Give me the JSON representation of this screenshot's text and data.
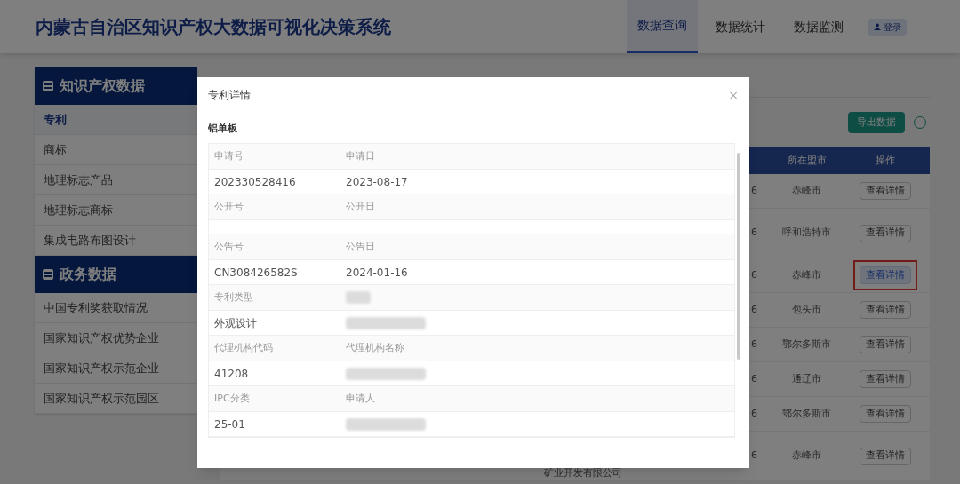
{
  "header": {
    "title": "内蒙古自治区知识产权大数据可视化决策系统",
    "nav": [
      {
        "label": "数据查询",
        "selected": true
      },
      {
        "label": "数据统计",
        "selected": false
      },
      {
        "label": "数据监测",
        "selected": false
      }
    ],
    "login": "登录"
  },
  "sidebar": {
    "groups": [
      {
        "title": "知识产权数据",
        "items": [
          {
            "label": "专利",
            "selected": true
          },
          {
            "label": "商标",
            "selected": false
          },
          {
            "label": "地理标志产品",
            "selected": false
          },
          {
            "label": "地理标志商标",
            "selected": false
          },
          {
            "label": "集成电路布图设计",
            "selected": false
          }
        ]
      },
      {
        "title": "政务数据",
        "items": [
          {
            "label": "中国专利奖获取情况",
            "selected": false
          },
          {
            "label": "国家知识产权优势企业",
            "selected": false
          },
          {
            "label": "国家知识产权示范企业",
            "selected": false
          },
          {
            "label": "国家知识产权示范园区",
            "selected": false
          }
        ]
      }
    ]
  },
  "content": {
    "export_button": "导出数据",
    "table": {
      "columns": [
        "所在盟市",
        "操作"
      ],
      "rows": [
        {
          "column_1": "6",
          "city": "赤峰市",
          "action": "查看详情",
          "highlighted": false,
          "tall": false
        },
        {
          "column_1": "6",
          "city": "呼和浩特市",
          "action": "查看详情",
          "highlighted": false,
          "tall": true
        },
        {
          "column_1": "6",
          "city": "赤峰市",
          "action": "查看详情",
          "highlighted": true,
          "tall": false
        },
        {
          "column_1": "6",
          "city": "包头市",
          "action": "查看详情",
          "highlighted": false,
          "tall": false
        },
        {
          "column_1": "6",
          "city": "鄂尔多斯市",
          "action": "查看详情",
          "highlighted": false,
          "tall": false
        },
        {
          "column_1": "6",
          "city": "通辽市",
          "action": "查看详情",
          "highlighted": false,
          "tall": false
        },
        {
          "column_1": "6",
          "city": "鄂尔多斯市",
          "action": "查看详情",
          "highlighted": false,
          "tall": false
        },
        {
          "column_1": "6",
          "city": "赤峰市",
          "action": "查看详情",
          "highlighted": false,
          "tall": true,
          "column_0": "矿业开发有限公司"
        }
      ]
    }
  },
  "dialog": {
    "title": "专利详情",
    "close": "×",
    "section_title": "铝单板",
    "rows": [
      {
        "kind": "label",
        "cells": [
          {
            "text": "申请号"
          },
          {
            "text": "申请日"
          }
        ]
      },
      {
        "kind": "value",
        "cells": [
          {
            "text": "202330528416"
          },
          {
            "text": "2023-08-17"
          }
        ]
      },
      {
        "kind": "label",
        "cells": [
          {
            "text": "公开号"
          },
          {
            "text": "公开日"
          }
        ]
      },
      {
        "kind": "empty",
        "cells": []
      },
      {
        "kind": "label",
        "cells": [
          {
            "text": "公告号"
          },
          {
            "text": "公告日"
          }
        ]
      },
      {
        "kind": "value",
        "cells": [
          {
            "text": "CN308426582S"
          },
          {
            "text": "2024-01-16"
          }
        ]
      },
      {
        "kind": "label",
        "cells": [
          {
            "text": "专利类型"
          },
          {
            "redacted": true
          }
        ]
      },
      {
        "kind": "value",
        "cells": [
          {
            "text": "外观设计"
          },
          {
            "redacted": true
          }
        ]
      },
      {
        "kind": "label",
        "cells": [
          {
            "text": "代理机构代码"
          },
          {
            "text": "代理机构名称"
          }
        ]
      },
      {
        "kind": "value",
        "cells": [
          {
            "text": "41208"
          },
          {
            "redacted": true
          }
        ]
      },
      {
        "kind": "label",
        "cells": [
          {
            "text": "IPC分类"
          },
          {
            "text": "申请人"
          }
        ]
      },
      {
        "kind": "value",
        "cells": [
          {
            "text": "25-01"
          },
          {
            "redacted": true
          }
        ]
      }
    ]
  }
}
